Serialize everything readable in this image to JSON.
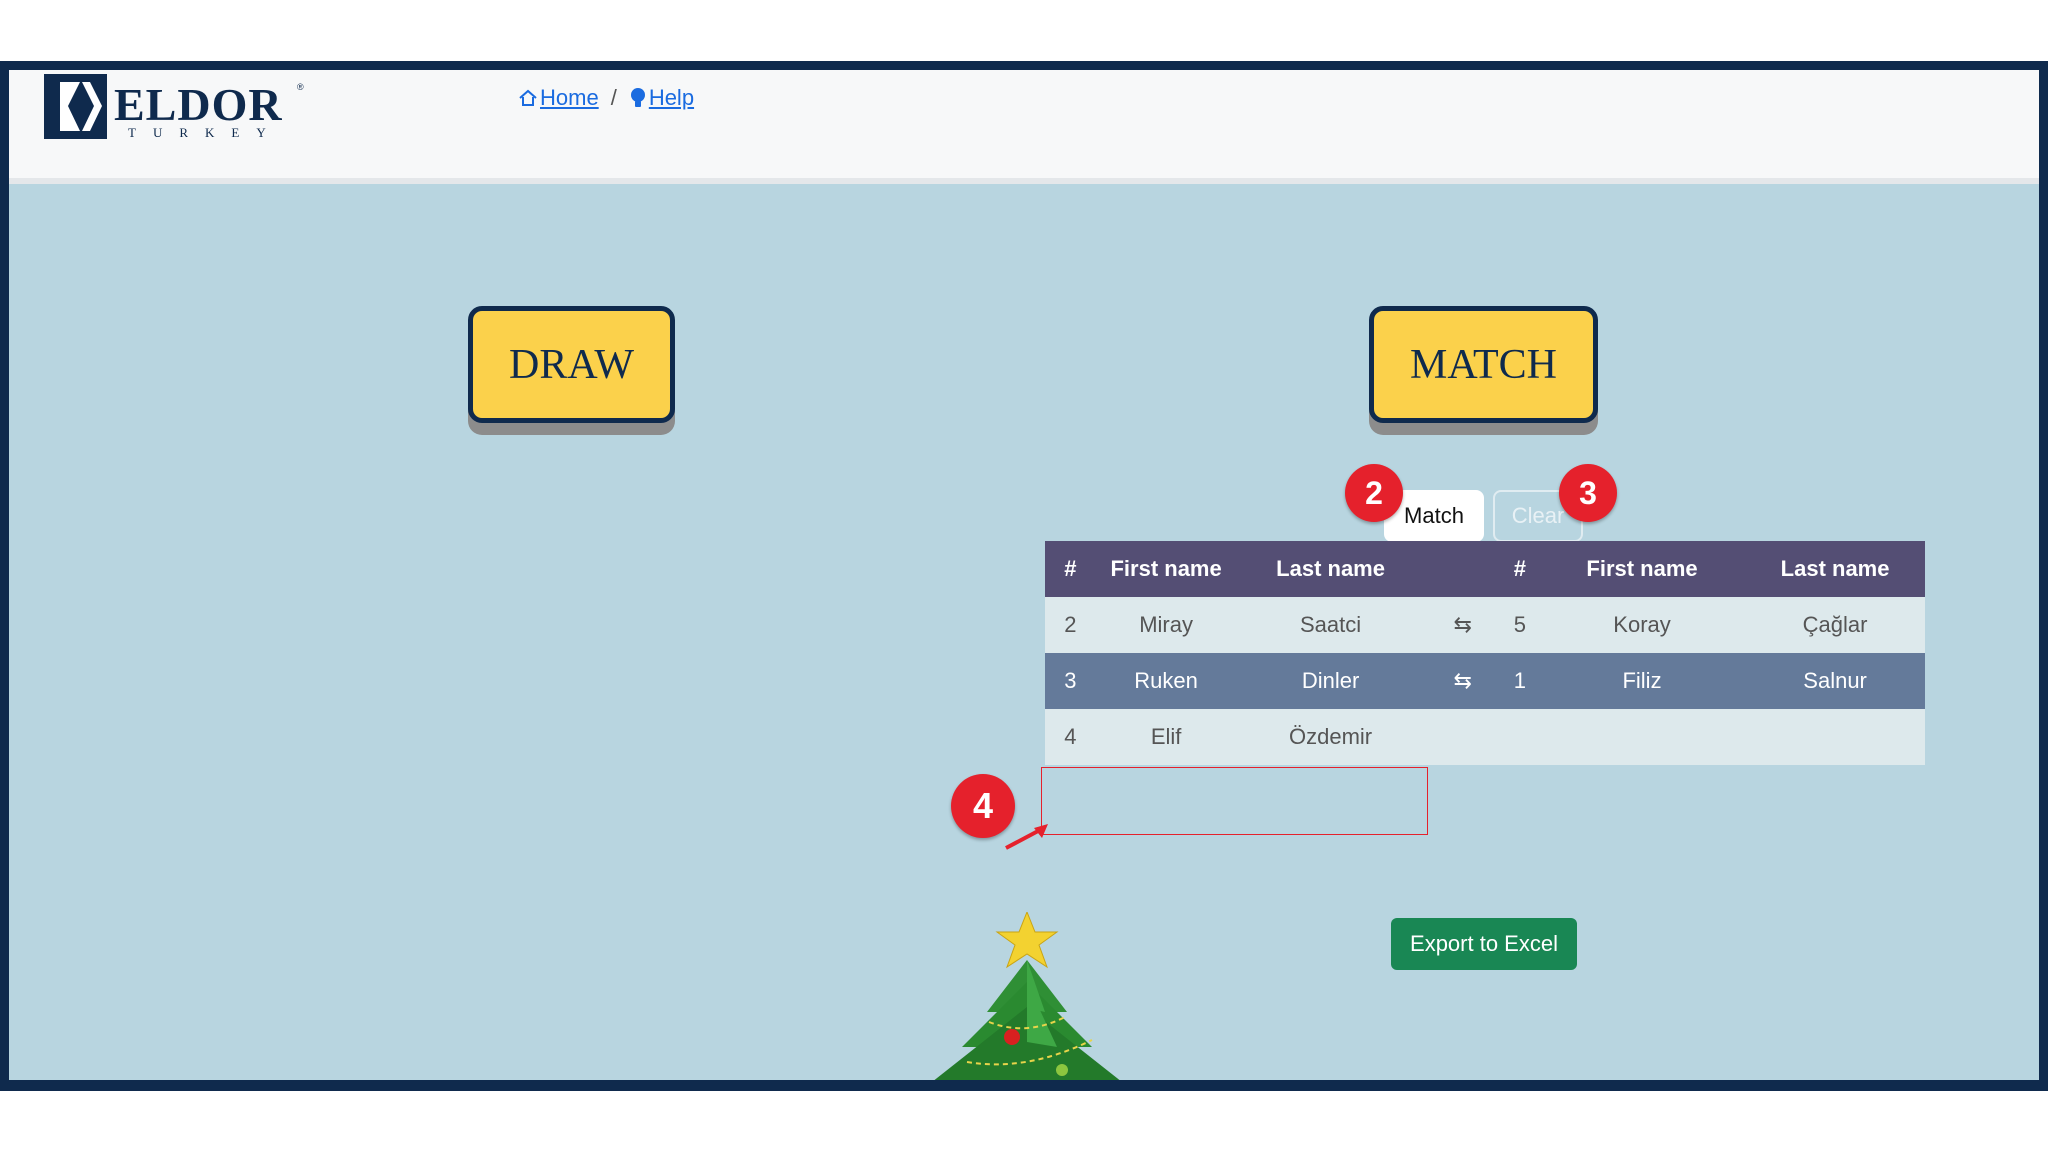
{
  "logo": {
    "word": "ELDOR",
    "sub": "TURKEY",
    "reg": "®"
  },
  "breadcrumb": {
    "home": "Home",
    "separator": "/",
    "help": "Help"
  },
  "buttons": {
    "draw": "DRAW",
    "match_big": "MATCH",
    "match": "Match",
    "clear": "Clear",
    "export": "Export to Excel"
  },
  "badges": {
    "b2": "2",
    "b3": "3",
    "b4": "4"
  },
  "table": {
    "headers": [
      "#",
      "First name",
      "Last name",
      "",
      "#",
      "First name",
      "Last name"
    ],
    "rows": [
      {
        "n1": "2",
        "f1": "Miray",
        "l1": "Saatci",
        "arrow": "⇆",
        "n2": "5",
        "f2": "Koray",
        "l2": "Çağlar"
      },
      {
        "n1": "3",
        "f1": "Ruken",
        "l1": "Dinler",
        "arrow": "⇆",
        "n2": "1",
        "f2": "Filiz",
        "l2": "Salnur"
      },
      {
        "n1": "4",
        "f1": "Elif",
        "l1": "Özdemir",
        "arrow": "",
        "n2": "",
        "f2": "",
        "l2": ""
      }
    ]
  },
  "colors": {
    "frame": "#0f2a4d",
    "background": "#b8d5e0",
    "button_yellow": "#fbd14b",
    "table_header": "#544e74",
    "row_highlight": "#647a9a",
    "badge_red": "#e5212c",
    "export_green": "#198754"
  },
  "icons": {
    "home": "home-icon",
    "help": "lightbulb-icon",
    "swap": "swap-arrows-icon",
    "tree": "christmas-tree"
  }
}
